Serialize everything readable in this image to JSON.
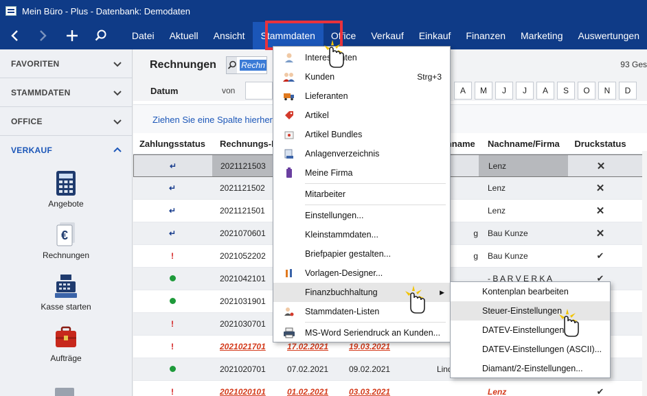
{
  "window": {
    "title": "Mein Büro - Plus - Datenbank: Demodaten"
  },
  "nav": {
    "buttons": [
      "back-icon",
      "forward-icon",
      "plus-icon",
      "search-icon"
    ],
    "menu": [
      "Datei",
      "Aktuell",
      "Ansicht",
      "Stammdaten",
      "Office",
      "Verkauf",
      "Einkauf",
      "Finanzen",
      "Marketing",
      "Auswertungen"
    ]
  },
  "sidebar": {
    "sections": [
      "FAVORITEN",
      "STAMMDATEN",
      "OFFICE",
      "VERKAUF"
    ],
    "tiles": [
      "Angebote",
      "Rechnungen",
      "Kasse starten",
      "Aufträge"
    ]
  },
  "main": {
    "title": "Rechnungen",
    "search_value": "Rechn",
    "count": "93 Ges",
    "filter_label": "Datum",
    "von_label": "von",
    "letters": [
      "A",
      "M",
      "J",
      "J",
      "A",
      "S",
      "O",
      "N",
      "D"
    ],
    "group_hint": "Ziehen Sie eine Spalte hierher,",
    "columns": [
      "Zahlungsstatus",
      "Rechnungs-N",
      "",
      "Nachname",
      "Nachname/Firma",
      "Druckstatus"
    ],
    "rows": [
      {
        "status": "arrow",
        "nr": "2021121503",
        "d1": "",
        "d2": "",
        "n": "",
        "firma": "Lenz",
        "druck": "x"
      },
      {
        "status": "arrow",
        "nr": "2021121502",
        "d1": "",
        "d2": "",
        "n": "",
        "firma": "Lenz",
        "druck": "x"
      },
      {
        "status": "arrow",
        "nr": "2021121501",
        "d1": "",
        "d2": "",
        "n": "",
        "firma": "Lenz",
        "druck": "x"
      },
      {
        "status": "arrow",
        "nr": "2021070601",
        "d1": "",
        "d2": "",
        "n": "g",
        "firma": "Bau Kunze",
        "druck": "x"
      },
      {
        "status": "excl",
        "nr": "2021052202",
        "d1": "",
        "d2": "",
        "n": "g",
        "firma": "Bau Kunze",
        "druck": "check"
      },
      {
        "status": "dot",
        "nr": "2021042101",
        "d1": "",
        "d2": "",
        "n": "",
        "firma": "- B A R V E R K A",
        "druck": "check"
      },
      {
        "status": "dot",
        "nr": "2021031901",
        "d1": "",
        "d2": "",
        "n": "",
        "firma": "",
        "druck": ""
      },
      {
        "status": "excl",
        "nr": "2021030701",
        "d1": "",
        "d2": "",
        "n": "",
        "firma": "",
        "druck": ""
      },
      {
        "status": "excl",
        "nr": "2021021701",
        "d1": "17.02.2021",
        "d2": "19.03.2021",
        "n": "",
        "firma": "",
        "druck": "",
        "overdue": true
      },
      {
        "status": "dot",
        "nr": "2021020701",
        "d1": "07.02.2021",
        "d2": "09.02.2021",
        "n": "Lindenberg",
        "firma": "",
        "druck": ""
      },
      {
        "status": "excl",
        "nr": "2021020101",
        "d1": "01.02.2021",
        "d2": "03.03.2021",
        "n": "",
        "firma": "Lenz",
        "druck": "check",
        "overdue": true
      }
    ]
  },
  "dropdown": {
    "items": [
      {
        "label": "Interessenten",
        "icon": "person-icon"
      },
      {
        "label": "Kunden",
        "icon": "customers-icon",
        "shortcut": "Strg+3"
      },
      {
        "label": "Lieferanten",
        "icon": "truck-icon"
      },
      {
        "label": "Artikel",
        "icon": "tag-icon"
      },
      {
        "label": "Artikel Bundles",
        "icon": "bundle-icon"
      },
      {
        "label": "Anlagenverzeichnis",
        "icon": "assets-icon"
      },
      {
        "label": "Meine Firma",
        "icon": "building-icon"
      },
      {
        "label": "Mitarbeiter",
        "icon": ""
      },
      {
        "label": "Einstellungen...",
        "icon": ""
      },
      {
        "label": "Kleinstammdaten...",
        "icon": ""
      },
      {
        "label": "Briefpapier gestalten...",
        "icon": ""
      },
      {
        "label": "Vorlagen-Designer...",
        "icon": "designer-icon"
      },
      {
        "label": "Finanzbuchhaltung",
        "icon": ""
      },
      {
        "label": "Stammdaten-Listen",
        "icon": "list-person-icon"
      },
      {
        "label": "MS-Word Seriendruck an Kunden...",
        "icon": "printer-icon"
      }
    ]
  },
  "submenu": {
    "items": [
      "Kontenplan bearbeiten",
      "Steuer-Einstellungen",
      "DATEV-Einstellungen (...",
      "DATEV-Einstellungen (ASCII)...",
      "Diamant/2-Einstellungen..."
    ]
  },
  "colors": {
    "nav_bg": "#0f3b87",
    "accent": "#1b56b8",
    "highlight": "#e8323c"
  }
}
